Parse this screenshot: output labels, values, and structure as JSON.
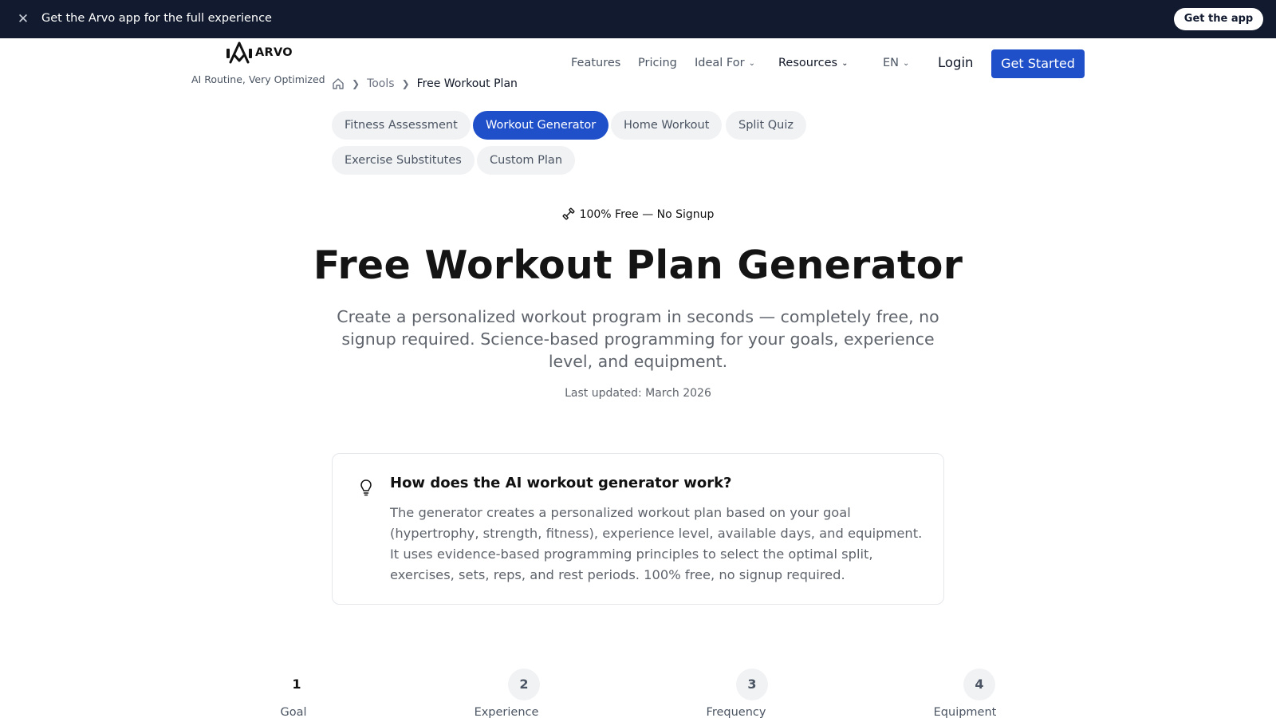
{
  "banner": {
    "text": "Get the Arvo app for the full experience",
    "button": "Get the app",
    "close_icon": "close-icon",
    "background": "#111a2e"
  },
  "header": {
    "logo_text": "ARVO",
    "tagline": "AI Routine, Very Optimized",
    "nav": {
      "features": "Features",
      "pricing": "Pricing",
      "ideal_for": "Ideal For",
      "resources": "Resources",
      "language": "EN"
    },
    "login": "Login",
    "cta": "Get Started",
    "accent": "#1f4fc9"
  },
  "breadcrumb": {
    "home_icon": "home-icon",
    "tools": "Tools",
    "current": "Free Workout Plan"
  },
  "tool_tabs": [
    {
      "label": "Fitness Assessment",
      "active": false
    },
    {
      "label": "Workout Generator",
      "active": true
    },
    {
      "label": "Home Workout",
      "active": false
    },
    {
      "label": "Split Quiz",
      "active": false
    },
    {
      "label": "Exercise Substitutes",
      "active": false
    },
    {
      "label": "Custom Plan",
      "active": false
    }
  ],
  "hero": {
    "badge": "100% Free — No Signup",
    "badge_icon": "dumbbell-icon",
    "title": "Free Workout Plan Generator",
    "subtitle": "Create a personalized workout program in seconds — completely free, no signup required. Science-based programming for your goals, experience level, and equipment.",
    "updated": "Last updated: March 2026"
  },
  "info_card": {
    "icon": "lightbulb-icon",
    "title": "How does the AI workout generator work?",
    "body": "The generator creates a personalized workout plan based on your goal (hypertrophy, strength, fitness), experience level, available days, and equipment. It uses evidence-based programming principles to select the optimal split, exercises, sets, reps, and rest periods. 100% free, no signup required."
  },
  "steps": [
    {
      "number": "1",
      "label": "Goal",
      "current": true
    },
    {
      "number": "2",
      "label": "Experience",
      "current": false
    },
    {
      "number": "3",
      "label": "Frequency",
      "current": false
    },
    {
      "number": "4",
      "label": "Equipment",
      "current": false
    }
  ]
}
